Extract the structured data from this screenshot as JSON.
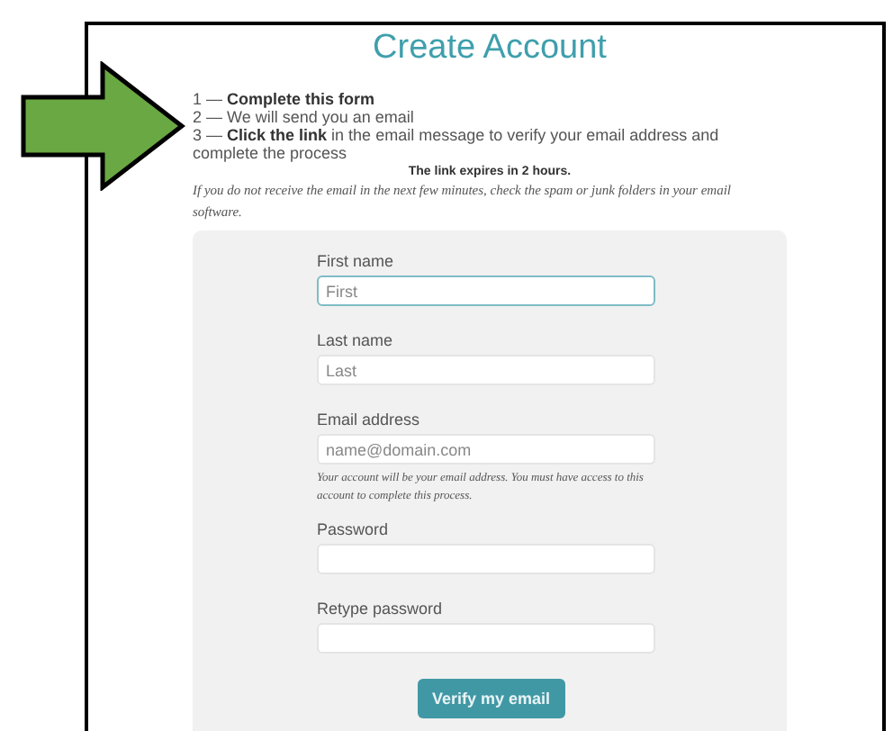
{
  "title": "Create Account",
  "steps": [
    {
      "text": "1 — **Complete this form**"
    },
    {
      "text": "2 — We will send you an email"
    },
    {
      "text": "3 — **Click the link** in the email message to verify your email address and complete the process"
    }
  ],
  "expiry_note": "The link expires in 2 hours.",
  "spam_note": "If you do not receive the email in the next few minutes, check the spam or junk folders in your email software.",
  "form": {
    "fields": [
      {
        "label": "First name",
        "placeholder": "First",
        "focused": true
      },
      {
        "label": "Last name",
        "placeholder": "Last",
        "focused": false
      },
      {
        "label": "Email address",
        "placeholder": "name@domain.com",
        "focused": false,
        "hint": "Your account will be your email address. You must have access to this account to complete this process."
      },
      {
        "label": "Password",
        "focused": false
      },
      {
        "label": "Retype password",
        "focused": false
      }
    ],
    "submit": "Verify my email"
  }
}
